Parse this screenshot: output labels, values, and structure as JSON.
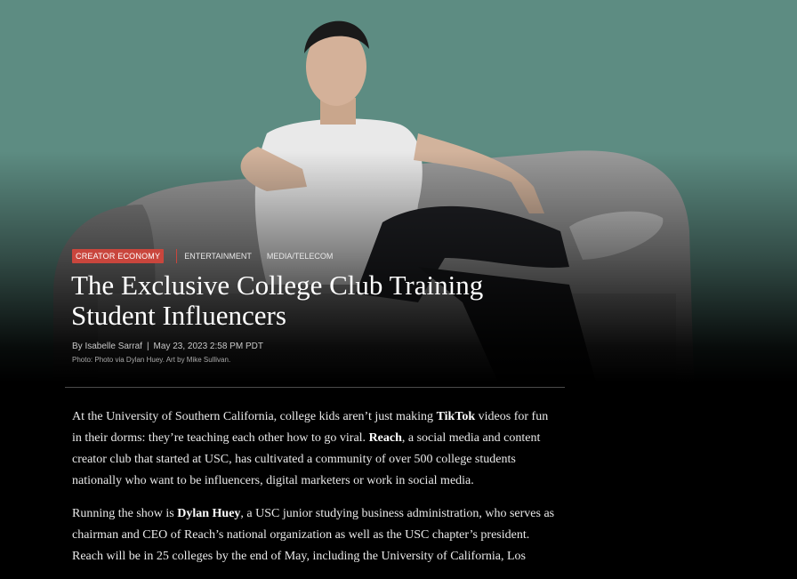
{
  "header": {
    "tags": [
      "CREATOR ECONOMY",
      "ENTERTAINMENT",
      "MEDIA/TELECOM"
    ]
  },
  "article": {
    "title": "The Exclusive College Club Training Student Influencers",
    "author": "By Isabelle Sarraf",
    "date": "May 23, 2023 2:58 PM PDT",
    "photo_credit": "Photo: Photo via Dylan Huey. Art by Mike Sullivan.",
    "paragraphs": [
      {
        "t1": "At the University of Southern California, college kids aren’t just making ",
        "b1": "TikTok",
        "t2": " videos for fun in their dorms: they’re teaching each other how to go viral. ",
        "b2": "Reach",
        "t3": ", a social media and content creator club that started at USC, has cultivated a community of over 500 college students nationally who want to be influencers, digital marketers or work in social media."
      },
      {
        "t1": "Running the show is ",
        "b1": "Dylan Huey",
        "t2": ", a USC junior studying business administration, who serves as chairman and CEO of Reach’s national organization as well as the USC chapter’s president. Reach will be in 25 colleges by the end of May, including the University of California, Los"
      }
    ]
  },
  "colors": {
    "hero_background": "#5d8c82",
    "tag_accent": "#c9463d",
    "page_background": "#000000"
  }
}
